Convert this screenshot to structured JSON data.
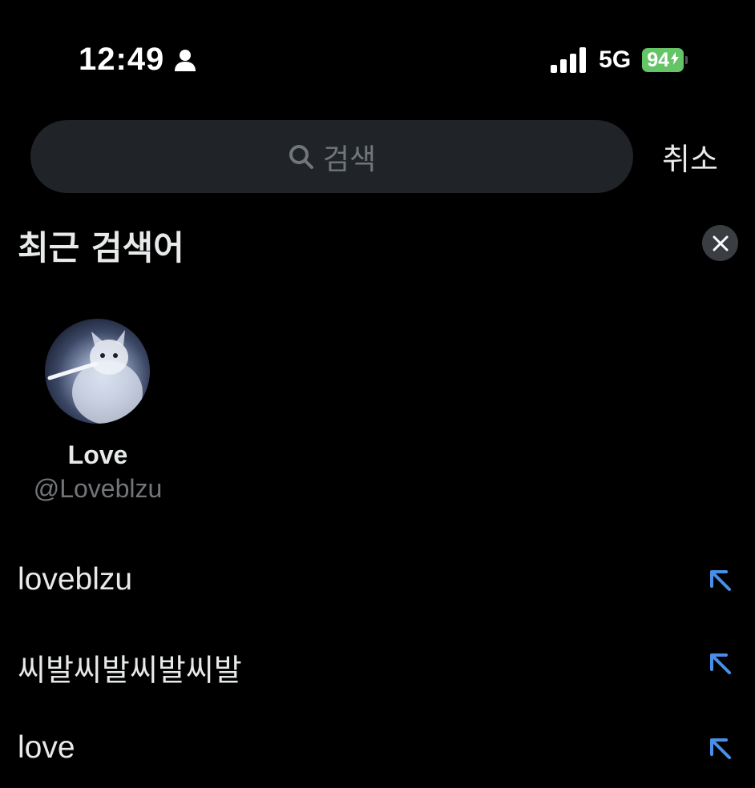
{
  "status_bar": {
    "time": "12:49",
    "network": "5G",
    "battery_level": "94",
    "battery_color": "#64c466",
    "icons": [
      "person-icon",
      "signal-icon",
      "charging-bolt-icon"
    ]
  },
  "search": {
    "placeholder": "검색",
    "icon": "search-icon",
    "cancel_label": "취소"
  },
  "recent": {
    "title": "최근 검색어",
    "clear_icon": "close-icon",
    "account": {
      "name": "Love",
      "handle": "@Loveblzu"
    },
    "queries": [
      {
        "text": "loveblzu",
        "icon": "arrow-up-left-icon"
      },
      {
        "text": "씨발씨발씨발씨발",
        "icon": "arrow-up-left-icon"
      },
      {
        "text": "love",
        "icon": "arrow-up-left-icon"
      }
    ]
  },
  "colors": {
    "background": "#000000",
    "search_field": "#202327",
    "primary_text": "#e7e9ea",
    "secondary_text": "#71767b",
    "accent": "#1d9bf0"
  }
}
